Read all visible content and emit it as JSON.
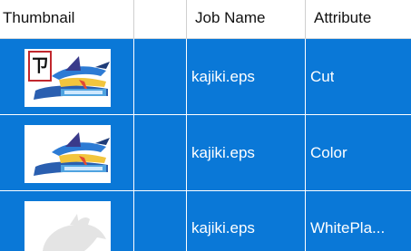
{
  "columns": {
    "thumbnail": "Thumbnail",
    "blank": "",
    "job_name": "Job Name",
    "attribute": "Attribute"
  },
  "rows": [
    {
      "job_name": "kajiki.eps",
      "attribute": "Cut",
      "thumbnail": "marlin-artwork-cut"
    },
    {
      "job_name": "kajiki.eps",
      "attribute": "Color",
      "thumbnail": "marlin-artwork-color"
    },
    {
      "job_name": "kajiki.eps",
      "attribute": "WhitePla...",
      "thumbnail": "marlin-artwork-white"
    }
  ],
  "colors": {
    "selection": "#0a78d7",
    "header_bg": "#ffffff",
    "cut_line": "#c1272d"
  }
}
